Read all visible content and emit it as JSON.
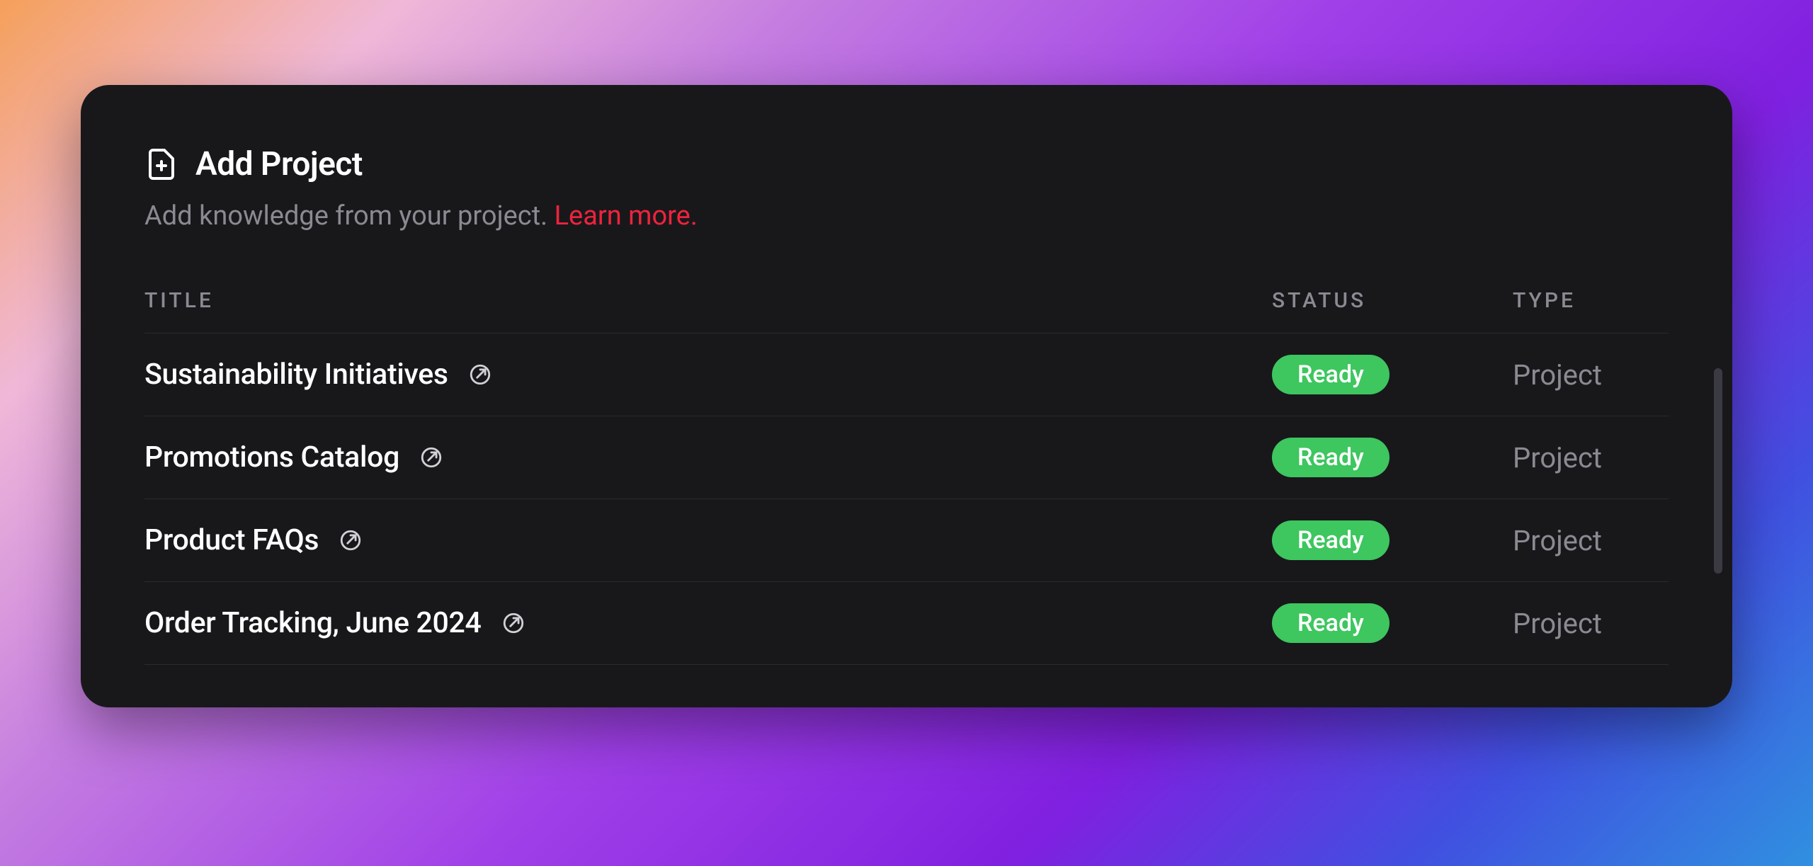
{
  "header": {
    "title": "Add Project",
    "subtitle_text": "Add knowledge from your project. ",
    "learn_more": "Learn more."
  },
  "columns": {
    "title": "TITLE",
    "status": "STATUS",
    "type": "TYPE"
  },
  "rows": [
    {
      "title": "Sustainability Initiatives",
      "status": "Ready",
      "type": "Project"
    },
    {
      "title": "Promotions Catalog",
      "status": "Ready",
      "type": "Project"
    },
    {
      "title": "Product FAQs",
      "status": "Ready",
      "type": "Project"
    },
    {
      "title": "Order Tracking, June 2024",
      "status": "Ready",
      "type": "Project"
    }
  ]
}
